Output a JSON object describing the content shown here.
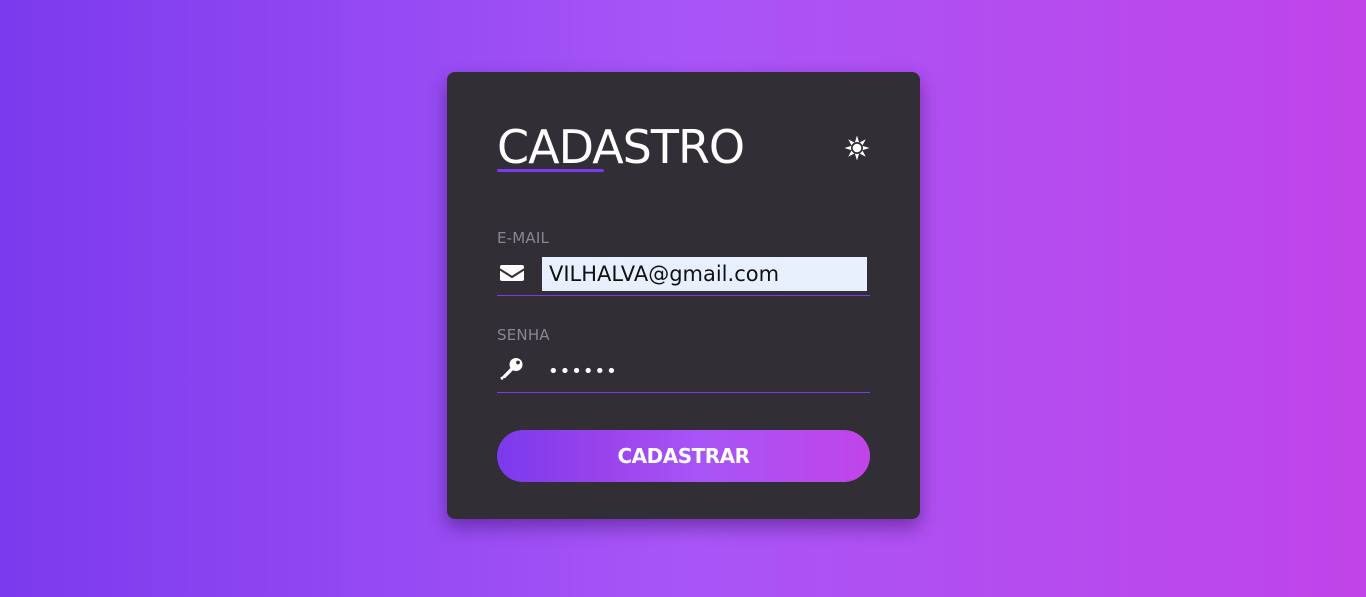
{
  "form": {
    "title": "CADASTRO",
    "email": {
      "label": "E-MAIL",
      "value": "VILHALVA@gmail.com",
      "icon": "envelope-icon"
    },
    "password": {
      "label": "SENHA",
      "value": "••••••",
      "icon": "key-icon"
    },
    "submit_label": "CADASTRAR",
    "theme_icon": "sun-icon"
  },
  "colors": {
    "accent": "#7b3aed",
    "gradient_start": "#7b3aed",
    "gradient_mid": "#a855f7",
    "gradient_end": "#c044e8",
    "card_background": "#312e36",
    "label_text": "#8a8591",
    "autofill_background": "#e8f0fe"
  }
}
